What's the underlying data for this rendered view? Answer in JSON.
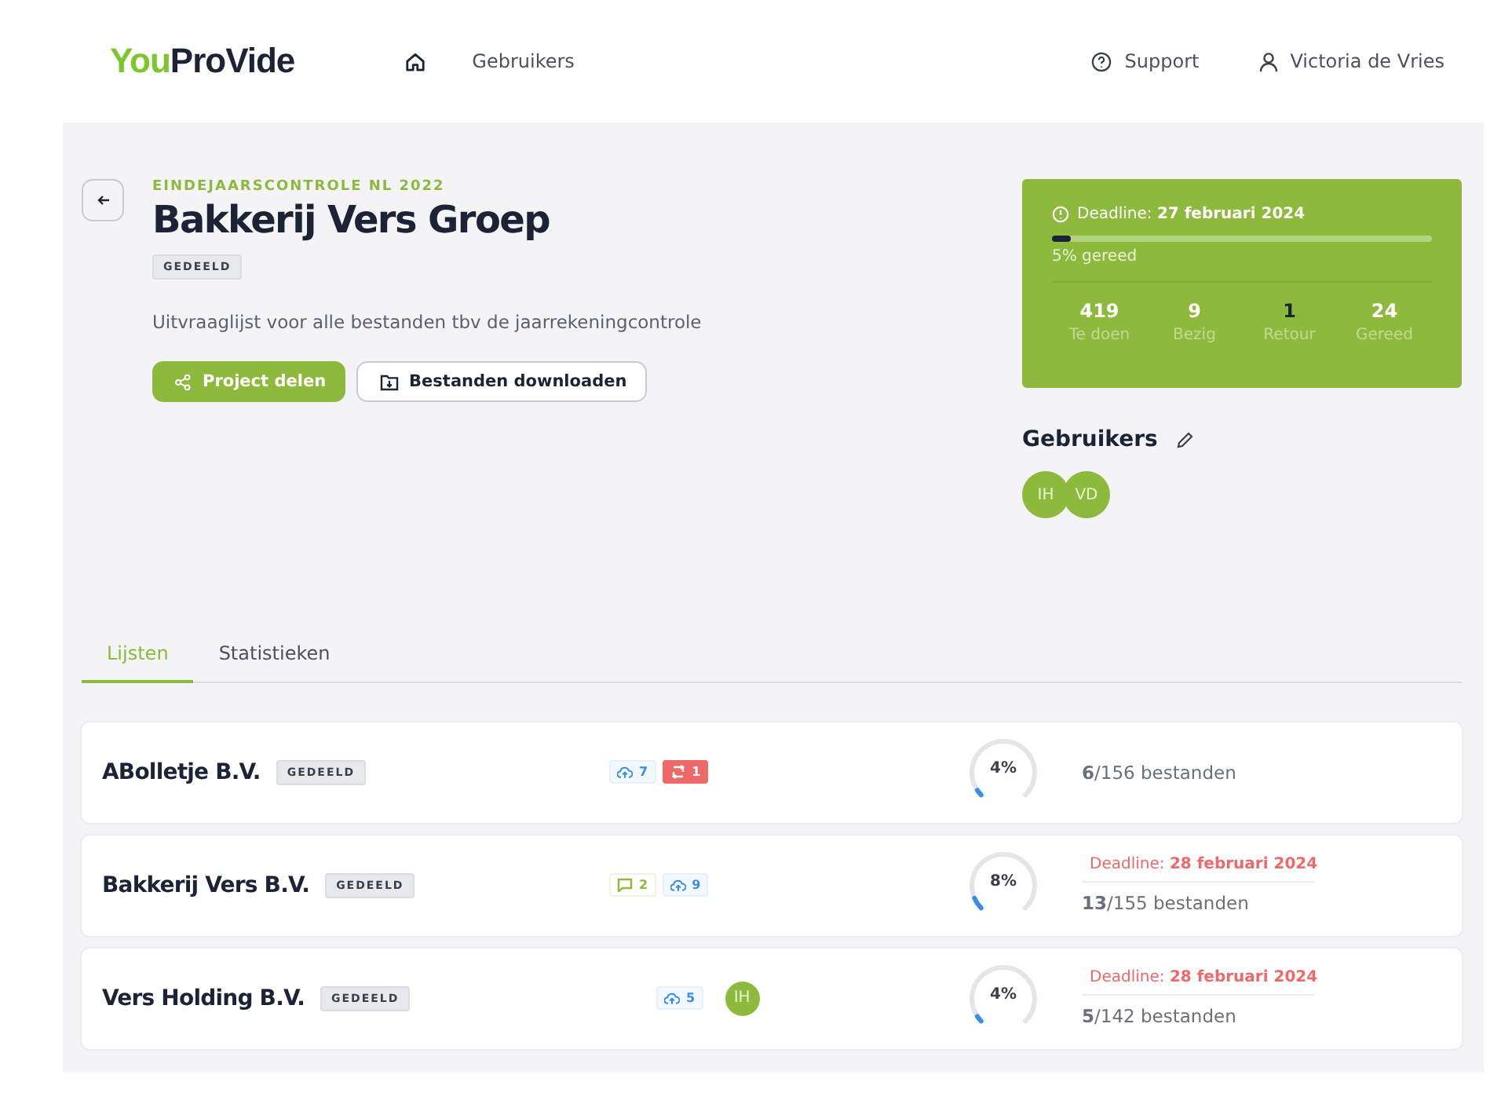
{
  "header": {
    "logo": {
      "accent": "You",
      "rest": "ProVide"
    },
    "nav": [
      {
        "kind": "home",
        "selected": true
      },
      {
        "kind": "link",
        "label": "Gebruikers",
        "selected": false
      }
    ],
    "support": "Support",
    "user": "Victoria de Vries"
  },
  "project": {
    "eyebrow": "EINDEJAARSCONTROLE NL 2022",
    "title": "Bakkerij Vers Groep",
    "badge": "GEDEELD",
    "description": "Uitvraaglijst voor alle bestanden tbv de jaarrekeningcontrole",
    "buttons": [
      {
        "kind": "share",
        "label": "Project delen"
      },
      {
        "kind": "download",
        "label": "Bestanden downloaden"
      }
    ]
  },
  "status": {
    "deadline": "Deadline: **27 februari 2024**",
    "level": 0.05,
    "progress_label": "5% gereed",
    "stats": [
      {
        "value": "419",
        "label": "Te doen"
      },
      {
        "value": "9",
        "label": "Bezig"
      },
      {
        "value": "1",
        "label": "Retour"
      },
      {
        "value": "24",
        "label": "Gereed"
      }
    ]
  },
  "users": {
    "title": "Gebruikers",
    "avatars": [
      "IH",
      "VD"
    ]
  },
  "tabs": [
    {
      "label": "Lijsten",
      "selected": true
    },
    {
      "label": "Statistieken",
      "selected": false
    }
  ],
  "lists": [
    {
      "name": "ABolletje B.V.",
      "badge": "GEDEELD",
      "indicators": [
        {
          "kind": "upload",
          "count": "7"
        },
        {
          "kind": "return",
          "count": "1"
        }
      ],
      "level": 0.04,
      "percent": "4%",
      "files": "**6**/156 bestanden"
    },
    {
      "name": "Bakkerij Vers B.V.",
      "badge": "GEDEELD",
      "indicators": [
        {
          "kind": "comment",
          "count": "2"
        },
        {
          "kind": "upload",
          "count": "9"
        }
      ],
      "level": 0.08,
      "percent": "8%",
      "deadline": "Deadline: **28 februari 2024**",
      "files": "**13**/155 bestanden"
    },
    {
      "name": "Vers Holding B.V.",
      "badge": "GEDEELD",
      "indicators": [
        {
          "kind": "upload",
          "count": "5"
        }
      ],
      "avatar": "IH",
      "level": 0.04,
      "percent": "4%",
      "deadline": "Deadline: **28 februari 2024**",
      "files": "**5**/142 bestanden"
    }
  ]
}
